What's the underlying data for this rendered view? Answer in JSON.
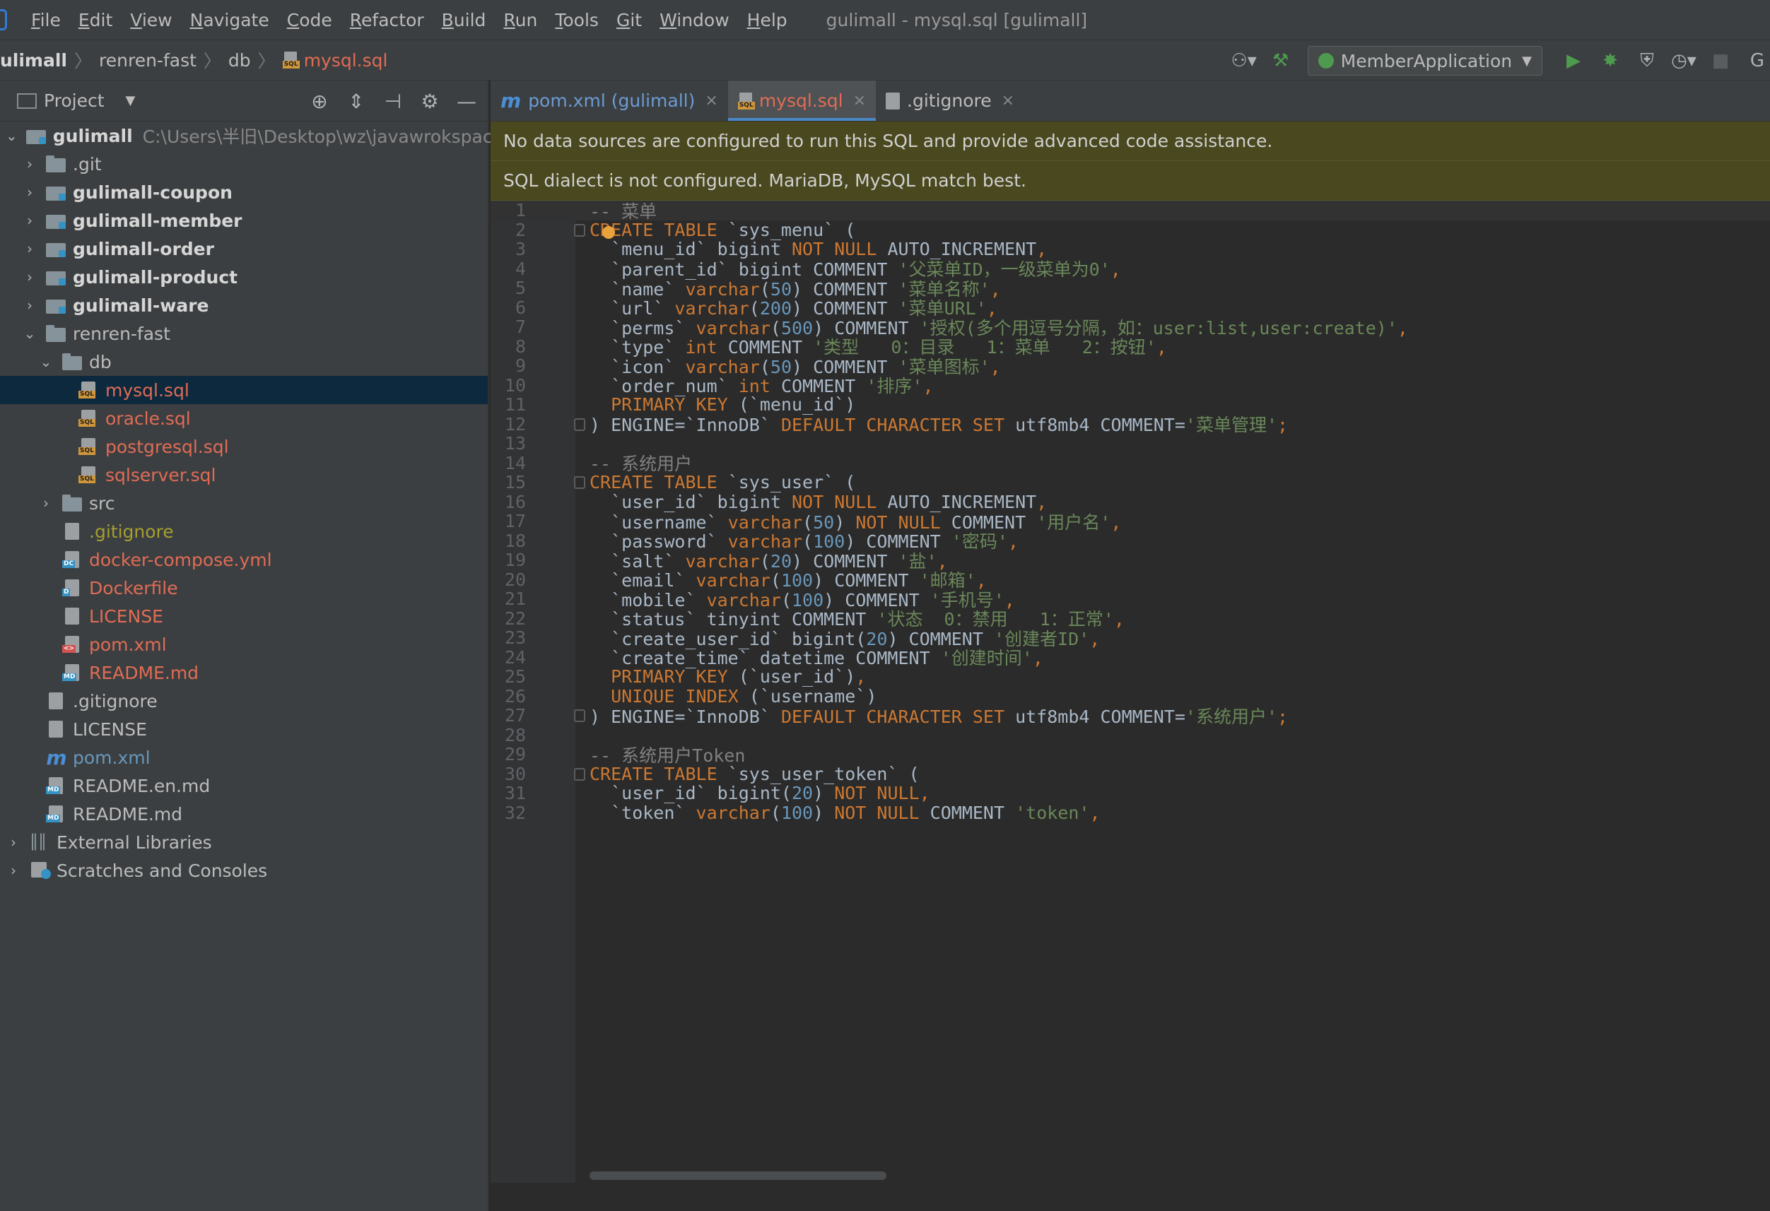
{
  "menu": {
    "items": [
      "File",
      "Edit",
      "View",
      "Navigate",
      "Code",
      "Refactor",
      "Build",
      "Run",
      "Tools",
      "Git",
      "Window",
      "Help"
    ],
    "title": "gulimall - mysql.sql [gulimall]"
  },
  "navbar": {
    "breadcrumb": [
      "ulimall",
      "renren-fast",
      "db",
      "mysql.sql"
    ],
    "run_config": "MemberApplication"
  },
  "project_panel": {
    "title": "Project",
    "tree": [
      {
        "label": "gulimall",
        "path": "C:\\Users\\半旧\\Desktop\\wz\\javawrokspace\\g",
        "indent": 0,
        "arrow": "down",
        "icon": "module",
        "style": "bold"
      },
      {
        "label": ".git",
        "indent": 1,
        "arrow": "right",
        "icon": "folder",
        "style": "normal"
      },
      {
        "label": "gulimall-coupon",
        "indent": 1,
        "arrow": "right",
        "icon": "module",
        "style": "bold"
      },
      {
        "label": "gulimall-member",
        "indent": 1,
        "arrow": "right",
        "icon": "module",
        "style": "bold"
      },
      {
        "label": "gulimall-order",
        "indent": 1,
        "arrow": "right",
        "icon": "module",
        "style": "bold"
      },
      {
        "label": "gulimall-product",
        "indent": 1,
        "arrow": "right",
        "icon": "module",
        "style": "bold"
      },
      {
        "label": "gulimall-ware",
        "indent": 1,
        "arrow": "right",
        "icon": "module",
        "style": "bold"
      },
      {
        "label": "renren-fast",
        "indent": 1,
        "arrow": "down",
        "icon": "folder",
        "style": "normal"
      },
      {
        "label": "db",
        "indent": 2,
        "arrow": "down",
        "icon": "folder",
        "style": "normal"
      },
      {
        "label": "mysql.sql",
        "indent": 3,
        "arrow": "none",
        "icon": "sql",
        "style": "red",
        "selected": true
      },
      {
        "label": "oracle.sql",
        "indent": 3,
        "arrow": "none",
        "icon": "sql",
        "style": "red"
      },
      {
        "label": "postgresql.sql",
        "indent": 3,
        "arrow": "none",
        "icon": "sql",
        "style": "red"
      },
      {
        "label": "sqlserver.sql",
        "indent": 3,
        "arrow": "none",
        "icon": "sql",
        "style": "red"
      },
      {
        "label": "src",
        "indent": 2,
        "arrow": "right",
        "icon": "folder",
        "style": "normal"
      },
      {
        "label": ".gitignore",
        "indent": 2,
        "arrow": "none",
        "icon": "file",
        "style": "olive"
      },
      {
        "label": "docker-compose.yml",
        "indent": 2,
        "arrow": "none",
        "icon": "dc",
        "style": "red"
      },
      {
        "label": "Dockerfile",
        "indent": 2,
        "arrow": "none",
        "icon": "d",
        "style": "red"
      },
      {
        "label": "LICENSE",
        "indent": 2,
        "arrow": "none",
        "icon": "file",
        "style": "red"
      },
      {
        "label": "pom.xml",
        "indent": 2,
        "arrow": "none",
        "icon": "xml",
        "style": "red"
      },
      {
        "label": "README.md",
        "indent": 2,
        "arrow": "none",
        "icon": "md",
        "style": "red"
      },
      {
        "label": ".gitignore",
        "indent": 1,
        "arrow": "none",
        "icon": "file",
        "style": "normal"
      },
      {
        "label": "LICENSE",
        "indent": 1,
        "arrow": "none",
        "icon": "file",
        "style": "normal"
      },
      {
        "label": "pom.xml",
        "indent": 1,
        "arrow": "none",
        "icon": "maven",
        "style": "blue"
      },
      {
        "label": "README.en.md",
        "indent": 1,
        "arrow": "none",
        "icon": "md",
        "style": "normal"
      },
      {
        "label": "README.md",
        "indent": 1,
        "arrow": "none",
        "icon": "md",
        "style": "normal"
      },
      {
        "label": "External Libraries",
        "indent": 0,
        "arrow": "right",
        "icon": "lib",
        "style": "normal"
      },
      {
        "label": "Scratches and Consoles",
        "indent": 0,
        "arrow": "right",
        "icon": "scratch",
        "style": "normal"
      }
    ]
  },
  "tabs": [
    {
      "label": "pom.xml (gulimall)",
      "icon": "maven",
      "active": false
    },
    {
      "label": "mysql.sql",
      "icon": "sql",
      "active": true
    },
    {
      "label": ".gitignore",
      "icon": "git",
      "active": false
    }
  ],
  "banners": [
    "No data sources are configured to run this SQL and provide advanced code assistance.",
    "SQL dialect is not configured. MariaDB, MySQL match best."
  ],
  "code_lines": [
    [
      [
        "cm",
        "-- 菜单"
      ]
    ],
    [
      [
        "kw",
        "CREATE TABLE "
      ],
      [
        "t",
        "`sys_menu` ("
      ]
    ],
    [
      [
        "t",
        "  `menu_id` bigint "
      ],
      [
        "kw",
        "NOT NULL "
      ],
      [
        "t",
        "AUTO_INCREMENT"
      ],
      [
        "kw",
        ","
      ]
    ],
    [
      [
        "t",
        "  `parent_id` bigint COMMENT "
      ],
      [
        "str",
        "'父菜单ID，一级菜单为0'"
      ],
      [
        "kw",
        ","
      ]
    ],
    [
      [
        "t",
        "  `name` "
      ],
      [
        "kw",
        "varchar"
      ],
      [
        "t",
        "("
      ],
      [
        "num",
        "50"
      ],
      [
        "t",
        ") COMMENT "
      ],
      [
        "str",
        "'菜单名称'"
      ],
      [
        "kw",
        ","
      ]
    ],
    [
      [
        "t",
        "  `url` "
      ],
      [
        "kw",
        "varchar"
      ],
      [
        "t",
        "("
      ],
      [
        "num",
        "200"
      ],
      [
        "t",
        ") COMMENT "
      ],
      [
        "str",
        "'菜单URL'"
      ],
      [
        "kw",
        ","
      ]
    ],
    [
      [
        "t",
        "  `perms` "
      ],
      [
        "kw",
        "varchar"
      ],
      [
        "t",
        "("
      ],
      [
        "num",
        "500"
      ],
      [
        "t",
        ") COMMENT "
      ],
      [
        "str",
        "'授权(多个用逗号分隔，如：user:list,user:create)'"
      ],
      [
        "kw",
        ","
      ]
    ],
    [
      [
        "t",
        "  `type` "
      ],
      [
        "kw",
        "int "
      ],
      [
        "t",
        "COMMENT "
      ],
      [
        "str",
        "'类型   0：目录   1：菜单   2：按钮'"
      ],
      [
        "kw",
        ","
      ]
    ],
    [
      [
        "t",
        "  `icon` "
      ],
      [
        "kw",
        "varchar"
      ],
      [
        "t",
        "("
      ],
      [
        "num",
        "50"
      ],
      [
        "t",
        ") COMMENT "
      ],
      [
        "str",
        "'菜单图标'"
      ],
      [
        "kw",
        ","
      ]
    ],
    [
      [
        "t",
        "  `order_num` "
      ],
      [
        "kw",
        "int "
      ],
      [
        "t",
        "COMMENT "
      ],
      [
        "str",
        "'排序'"
      ],
      [
        "kw",
        ","
      ]
    ],
    [
      [
        "kw",
        "  PRIMARY KEY "
      ],
      [
        "t",
        "(`menu_id`)"
      ]
    ],
    [
      [
        "t",
        ") ENGINE=`InnoDB` "
      ],
      [
        "kw",
        "DEFAULT CHARACTER SET "
      ],
      [
        "t",
        "utf8mb4 COMMENT="
      ],
      [
        "str",
        "'菜单管理'"
      ],
      [
        "kw",
        ";"
      ]
    ],
    [],
    [
      [
        "cm",
        "-- 系统用户"
      ]
    ],
    [
      [
        "kw",
        "CREATE TABLE "
      ],
      [
        "t",
        "`sys_user` ("
      ]
    ],
    [
      [
        "t",
        "  `user_id` bigint "
      ],
      [
        "kw",
        "NOT NULL "
      ],
      [
        "t",
        "AUTO_INCREMENT"
      ],
      [
        "kw",
        ","
      ]
    ],
    [
      [
        "t",
        "  `username` "
      ],
      [
        "kw",
        "varchar"
      ],
      [
        "t",
        "("
      ],
      [
        "num",
        "50"
      ],
      [
        "t",
        ") "
      ],
      [
        "kw",
        "NOT NULL "
      ],
      [
        "t",
        "COMMENT "
      ],
      [
        "str",
        "'用户名'"
      ],
      [
        "kw",
        ","
      ]
    ],
    [
      [
        "t",
        "  `password` "
      ],
      [
        "kw",
        "varchar"
      ],
      [
        "t",
        "("
      ],
      [
        "num",
        "100"
      ],
      [
        "t",
        ") COMMENT "
      ],
      [
        "str",
        "'密码'"
      ],
      [
        "kw",
        ","
      ]
    ],
    [
      [
        "t",
        "  `salt` "
      ],
      [
        "kw",
        "varchar"
      ],
      [
        "t",
        "("
      ],
      [
        "num",
        "20"
      ],
      [
        "t",
        ") COMMENT "
      ],
      [
        "str",
        "'盐'"
      ],
      [
        "kw",
        ","
      ]
    ],
    [
      [
        "t",
        "  `email` "
      ],
      [
        "kw",
        "varchar"
      ],
      [
        "t",
        "("
      ],
      [
        "num",
        "100"
      ],
      [
        "t",
        ") COMMENT "
      ],
      [
        "str",
        "'邮箱'"
      ],
      [
        "kw",
        ","
      ]
    ],
    [
      [
        "t",
        "  `mobile` "
      ],
      [
        "kw",
        "varchar"
      ],
      [
        "t",
        "("
      ],
      [
        "num",
        "100"
      ],
      [
        "t",
        ") COMMENT "
      ],
      [
        "str",
        "'手机号'"
      ],
      [
        "kw",
        ","
      ]
    ],
    [
      [
        "t",
        "  `status` tinyint COMMENT "
      ],
      [
        "str",
        "'状态  0：禁用   1：正常'"
      ],
      [
        "kw",
        ","
      ]
    ],
    [
      [
        "t",
        "  `create_user_id` bigint("
      ],
      [
        "num",
        "20"
      ],
      [
        "t",
        ") COMMENT "
      ],
      [
        "str",
        "'创建者ID'"
      ],
      [
        "kw",
        ","
      ]
    ],
    [
      [
        "t",
        "  `create_time` datetime COMMENT "
      ],
      [
        "str",
        "'创建时间'"
      ],
      [
        "kw",
        ","
      ]
    ],
    [
      [
        "kw",
        "  PRIMARY KEY "
      ],
      [
        "t",
        "(`user_id`)"
      ],
      [
        "kw",
        ","
      ]
    ],
    [
      [
        "kw",
        "  UNIQUE INDEX "
      ],
      [
        "t",
        "(`username`)"
      ]
    ],
    [
      [
        "t",
        ") ENGINE=`InnoDB` "
      ],
      [
        "kw",
        "DEFAULT CHARACTER SET "
      ],
      [
        "t",
        "utf8mb4 COMMENT="
      ],
      [
        "str",
        "'系统用户'"
      ],
      [
        "kw",
        ";"
      ]
    ],
    [],
    [
      [
        "cm",
        "-- 系统用户Token"
      ]
    ],
    [
      [
        "kw",
        "CREATE TABLE "
      ],
      [
        "t",
        "`sys_user_token` ("
      ]
    ],
    [
      [
        "t",
        "  `user_id` bigint("
      ],
      [
        "num",
        "20"
      ],
      [
        "t",
        ") "
      ],
      [
        "kw",
        "NOT NULL"
      ],
      [
        "kw",
        ","
      ]
    ],
    [
      [
        "t",
        "  `token` "
      ],
      [
        "kw",
        "varchar"
      ],
      [
        "t",
        "("
      ],
      [
        "num",
        "100"
      ],
      [
        "t",
        ") "
      ],
      [
        "kw",
        "NOT NULL "
      ],
      [
        "t",
        "COMMENT "
      ],
      [
        "str",
        "'token'"
      ],
      [
        "kw",
        ","
      ]
    ]
  ],
  "fold_lines": [
    2,
    12,
    15,
    27,
    30
  ]
}
